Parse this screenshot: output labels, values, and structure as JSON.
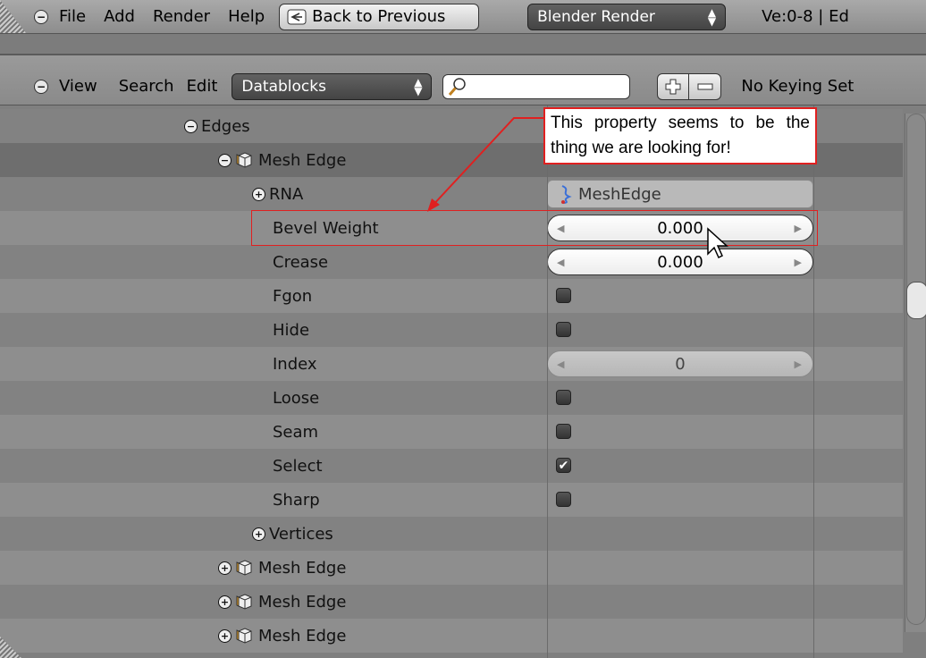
{
  "header_top": {
    "menus": [
      "File",
      "Add",
      "Render",
      "Help"
    ],
    "back_button": "Back to Previous",
    "render_engine": "Blender Render",
    "stats": "Ve:0-8 | Ed"
  },
  "header_outliner": {
    "menus": [
      "View",
      "Search",
      "Edit"
    ],
    "display_mode": "Datablocks",
    "search_placeholder": "",
    "keying_set": "No Keying Set"
  },
  "tree": {
    "edges_label": "Edges",
    "mesh_edge_label": "Mesh Edge",
    "rna_label": "RNA",
    "rna_value": "MeshEdge",
    "properties": [
      {
        "name": "Bevel Weight",
        "type": "number",
        "value": "0.000"
      },
      {
        "name": "Crease",
        "type": "number",
        "value": "0.000"
      },
      {
        "name": "Fgon",
        "type": "checkbox",
        "checked": false
      },
      {
        "name": "Hide",
        "type": "checkbox",
        "checked": false
      },
      {
        "name": "Index",
        "type": "readonly",
        "value": "0"
      },
      {
        "name": "Loose",
        "type": "checkbox",
        "checked": false
      },
      {
        "name": "Seam",
        "type": "checkbox",
        "checked": false
      },
      {
        "name": "Select",
        "type": "checkbox",
        "checked": true
      },
      {
        "name": "Sharp",
        "type": "checkbox",
        "checked": false
      }
    ],
    "vertices_label": "Vertices",
    "collapsed_mesh_edges": [
      "Mesh Edge",
      "Mesh Edge",
      "Mesh Edge"
    ]
  },
  "annotation": {
    "callout_text": "This property seems to be the thing we are looking for!",
    "color": "#e02020"
  }
}
